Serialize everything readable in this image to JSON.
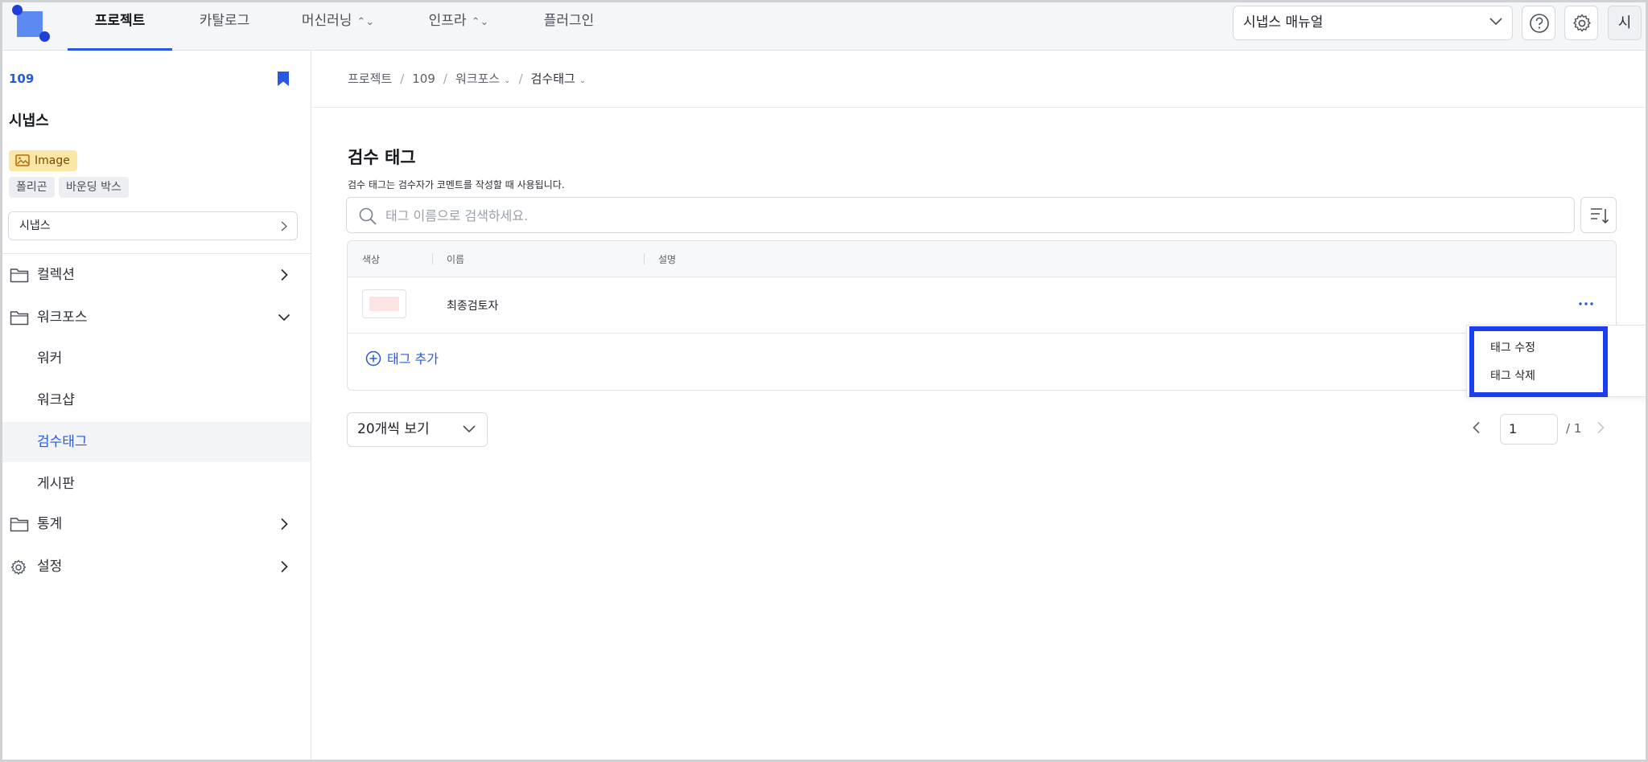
{
  "header": {
    "tabs": [
      {
        "label": "프로젝트",
        "active": true
      },
      {
        "label": "카탈로그",
        "active": false
      },
      {
        "label": "머신러닝",
        "active": false,
        "has_updown": true
      },
      {
        "label": "인프라",
        "active": false,
        "has_updown": true
      },
      {
        "label": "플러그인",
        "active": false
      }
    ],
    "manual_select": "시냅스 매뉴얼",
    "avatar_initial": "시",
    "icons": [
      "logo",
      "help-icon",
      "gear-icon"
    ]
  },
  "sidebar": {
    "project_id": "109",
    "project_name": "시냅스",
    "data_type_chip": "Image",
    "annotation_chips": [
      "폴리곤",
      "바운딩 박스"
    ],
    "project_select": "시냅스",
    "menu": {
      "collection": "컬렉션",
      "workforce": "워크포스",
      "sub_items": [
        "워커",
        "워크샵",
        "검수태그",
        "게시판"
      ],
      "active_sub_item": "검수태그",
      "stats": "통계",
      "settings": "설정"
    }
  },
  "breadcrumb": {
    "items": [
      "프로젝트",
      "109",
      "워크포스",
      "검수태그"
    ]
  },
  "main": {
    "title": "검수 태그",
    "description": "검수 태그는 검수자가 코멘트를 작성할 때 사용됩니다.",
    "search_placeholder": "태그 이름으로 검색하세요.",
    "table": {
      "columns": [
        "색상",
        "이름",
        "설명"
      ],
      "rows": [
        {
          "color": "#fde3e3",
          "name": "최종검토자",
          "description": ""
        }
      ],
      "add_tag_label": "태그 추가"
    },
    "context_menu": {
      "items": [
        "태그 수정",
        "태그 삭제"
      ]
    },
    "page_size_select": "20개씩 보기",
    "pagination": {
      "current": "1",
      "total": "/ 1"
    }
  },
  "colors": {
    "accent": "#2559e0",
    "highlight_box": "#1b3ff0",
    "image_chip_bg": "#fbe6a6",
    "active_row_bg": "#f2f4f7"
  }
}
